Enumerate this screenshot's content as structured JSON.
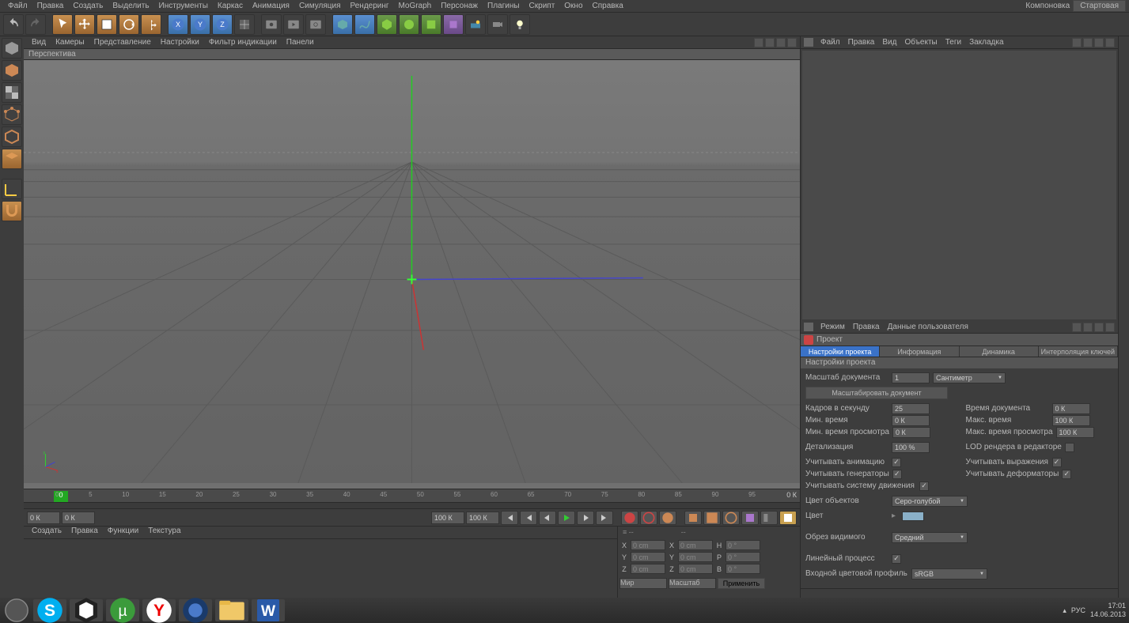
{
  "menubar": {
    "items": [
      "Файл",
      "Правка",
      "Создать",
      "Выделить",
      "Инструменты",
      "Каркас",
      "Анимация",
      "Симуляция",
      "Рендеринг",
      "MoGraph",
      "Персонаж",
      "Плагины",
      "Скрипт",
      "Окно",
      "Справка"
    ],
    "layout_label": "Компоновка",
    "layout_value": "Стартовая"
  },
  "viewport_menu": {
    "items": [
      "Вид",
      "Камеры",
      "Представление",
      "Настройки",
      "Фильтр индикации",
      "Панели"
    ]
  },
  "viewport": {
    "label": "Перспектива"
  },
  "timeline": {
    "current_frame": "0",
    "start": "0 К",
    "range_start": "0 К",
    "range_end": "100 К",
    "end": "100 К",
    "display_end": "0 К",
    "tick_labels": [
      "0",
      "5",
      "10",
      "15",
      "20",
      "25",
      "30",
      "35",
      "40",
      "45",
      "50",
      "55",
      "60",
      "65",
      "70",
      "75",
      "80",
      "85",
      "90",
      "95"
    ]
  },
  "materials_menu": {
    "items": [
      "Создать",
      "Правка",
      "Функции",
      "Текстура"
    ]
  },
  "coords": {
    "labels": {
      "x": "X",
      "y": "Y",
      "z": "Z",
      "h": "H",
      "p": "P",
      "b": "B"
    },
    "pos": {
      "x": "0 cm",
      "y": "0 cm",
      "z": "0 cm"
    },
    "size": {
      "x": "0 cm",
      "y": "0 cm",
      "z": "0 cm"
    },
    "rot": {
      "h": "0 °",
      "p": "0 °",
      "b": "0 °"
    },
    "mode1": "Мир",
    "mode2": "Масштаб",
    "apply": "Применить"
  },
  "objects_panel": {
    "menu": [
      "Файл",
      "Правка",
      "Вид",
      "Объекты",
      "Теги",
      "Закладка"
    ]
  },
  "attributes_panel": {
    "menu": [
      "Режим",
      "Правка",
      "Данные пользователя"
    ],
    "title": "Проект",
    "tabs": [
      "Настройки проекта",
      "Информация",
      "Динамика",
      "Интерполяция ключей"
    ],
    "section_header": "Настройки проекта",
    "doc_scale_label": "Масштаб документа",
    "doc_scale_value": "1",
    "doc_scale_unit": "Сантиметр",
    "scale_doc_btn": "Масштабировать документ",
    "fps_label": "Кадров в секунду",
    "fps_value": "25",
    "doc_time_label": "Время документа",
    "doc_time_value": "0 К",
    "min_time_label": "Мин. время",
    "min_time_value": "0 К",
    "max_time_label": "Макс. время",
    "max_time_value": "100 К",
    "min_preview_label": "Мин. время просмотра",
    "min_preview_value": "0 К",
    "max_preview_label": "Макс. время просмотра",
    "max_preview_value": "100 К",
    "detail_label": "Детализация",
    "detail_value": "100 %",
    "lod_label": "LOD рендера в редакторе",
    "use_anim_label": "Учитывать анимацию",
    "use_expr_label": "Учитывать выражения",
    "use_gen_label": "Учитывать генераторы",
    "use_def_label": "Учитывать деформаторы",
    "use_motion_label": "Учитывать систему движения",
    "obj_color_label": "Цвет объектов",
    "obj_color_value": "Серо-голубой",
    "color_label": "Цвет",
    "crop_label": "Обрез видимого",
    "crop_value": "Средний",
    "linear_label": "Линейный процесс",
    "input_profile_label": "Входной цветовой профиль",
    "input_profile_value": "sRGB"
  },
  "taskbar": {
    "lang": "РУС",
    "time": "17:01",
    "date": "14.06.2013"
  }
}
